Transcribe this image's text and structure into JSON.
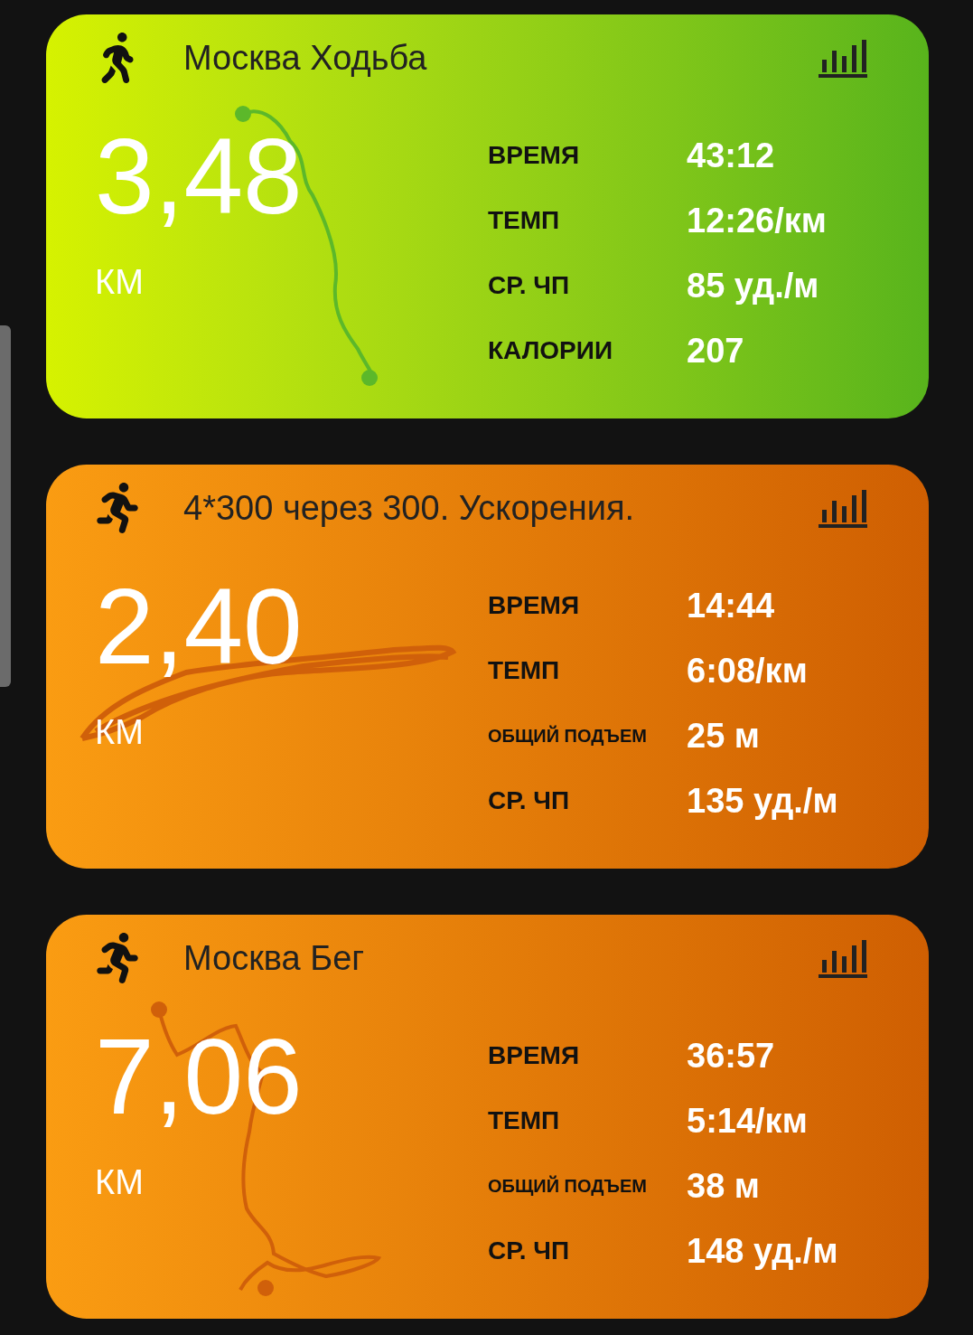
{
  "activities": [
    {
      "kind": "walk",
      "title": "Москва Ходьба",
      "distance": "3,48",
      "unit": "КМ",
      "stats": [
        {
          "kind": "short",
          "label": "ВРЕМЯ",
          "value": "43:12"
        },
        {
          "kind": "short",
          "label": "ТЕМП",
          "value": "12:26/км"
        },
        {
          "kind": "short",
          "label": "СР. ЧП",
          "value": "85 уд./м"
        },
        {
          "kind": "short",
          "label": "КАЛОРИИ",
          "value": "207"
        }
      ]
    },
    {
      "kind": "run",
      "title": "4*300 через 300. Ускорения.",
      "distance": "2,40",
      "unit": "КМ",
      "stats": [
        {
          "kind": "short",
          "label": "ВРЕМЯ",
          "value": "14:44"
        },
        {
          "kind": "short",
          "label": "ТЕМП",
          "value": "6:08/км"
        },
        {
          "kind": "long",
          "label": "ОБЩИЙ ПОДЪЕМ",
          "value": "25 м"
        },
        {
          "kind": "short",
          "label": "СР. ЧП",
          "value": "135 уд./м"
        }
      ]
    },
    {
      "kind": "run",
      "title": "Москва Бег",
      "distance": "7,06",
      "unit": "КМ",
      "stats": [
        {
          "kind": "short",
          "label": "ВРЕМЯ",
          "value": "36:57"
        },
        {
          "kind": "short",
          "label": "ТЕМП",
          "value": "5:14/км"
        },
        {
          "kind": "long",
          "label": "ОБЩИЙ ПОДЪЕМ",
          "value": "38 м"
        },
        {
          "kind": "short",
          "label": "СР. ЧП",
          "value": "148 уд./м"
        }
      ]
    }
  ]
}
